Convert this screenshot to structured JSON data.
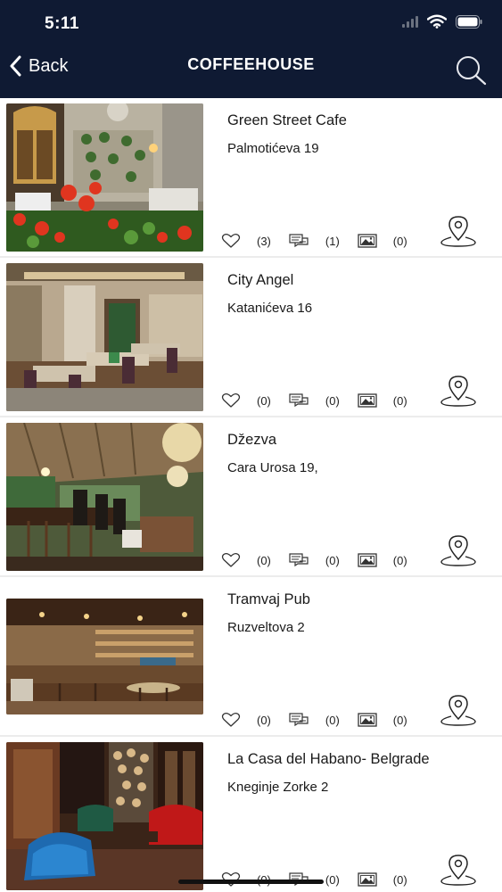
{
  "status_bar": {
    "time": "5:11"
  },
  "nav": {
    "back_label": "Back",
    "title": "COFFEEHOUSE"
  },
  "items": [
    {
      "name": "Green Street Cafe",
      "address": "Palmotićeva 19",
      "likes": "(3)",
      "comments": "(1)",
      "photos": "(0)"
    },
    {
      "name": "City Angel",
      "address": "Katanićeva 16",
      "likes": "(0)",
      "comments": "(0)",
      "photos": "(0)"
    },
    {
      "name": "Džezva",
      "address": "Cara Urosa 19,",
      "likes": "(0)",
      "comments": "(0)",
      "photos": "(0)"
    },
    {
      "name": "Tramvaj Pub",
      "address": "Ruzveltova 2",
      "likes": "(0)",
      "comments": "(0)",
      "photos": "(0)"
    },
    {
      "name": "La Casa del Habano- Belgrade",
      "address": "Kneginje Zorke 2",
      "likes": "(0)",
      "comments": "(0)",
      "photos": "(0)"
    }
  ],
  "icons": {
    "back": "chevron-left-icon",
    "search": "search-icon",
    "like": "heart-icon",
    "comment": "comments-icon",
    "photo": "image-icon",
    "location": "map-pin-icon"
  },
  "colors": {
    "header_bg": "#0f1a33",
    "divider": "#ececec"
  }
}
